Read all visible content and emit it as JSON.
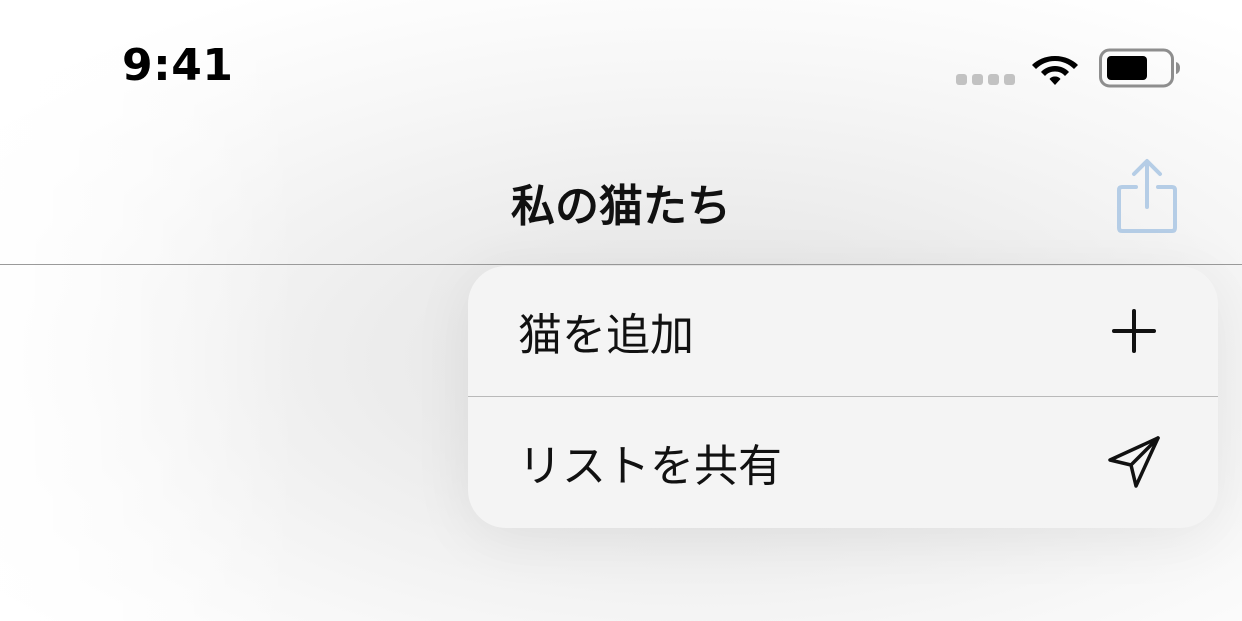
{
  "status_bar": {
    "time": "9:41",
    "signal_icon": "cellular-signal-icon",
    "wifi_icon": "wifi-icon",
    "battery_icon": "battery-icon"
  },
  "nav_bar": {
    "title": "私の猫たち",
    "share_icon": "share-icon",
    "share_icon_color": "#b5cde6"
  },
  "menu": {
    "items": [
      {
        "label": "猫を追加",
        "icon": "plus-icon"
      },
      {
        "label": "リストを共有",
        "icon": "paper-plane-icon"
      }
    ]
  }
}
